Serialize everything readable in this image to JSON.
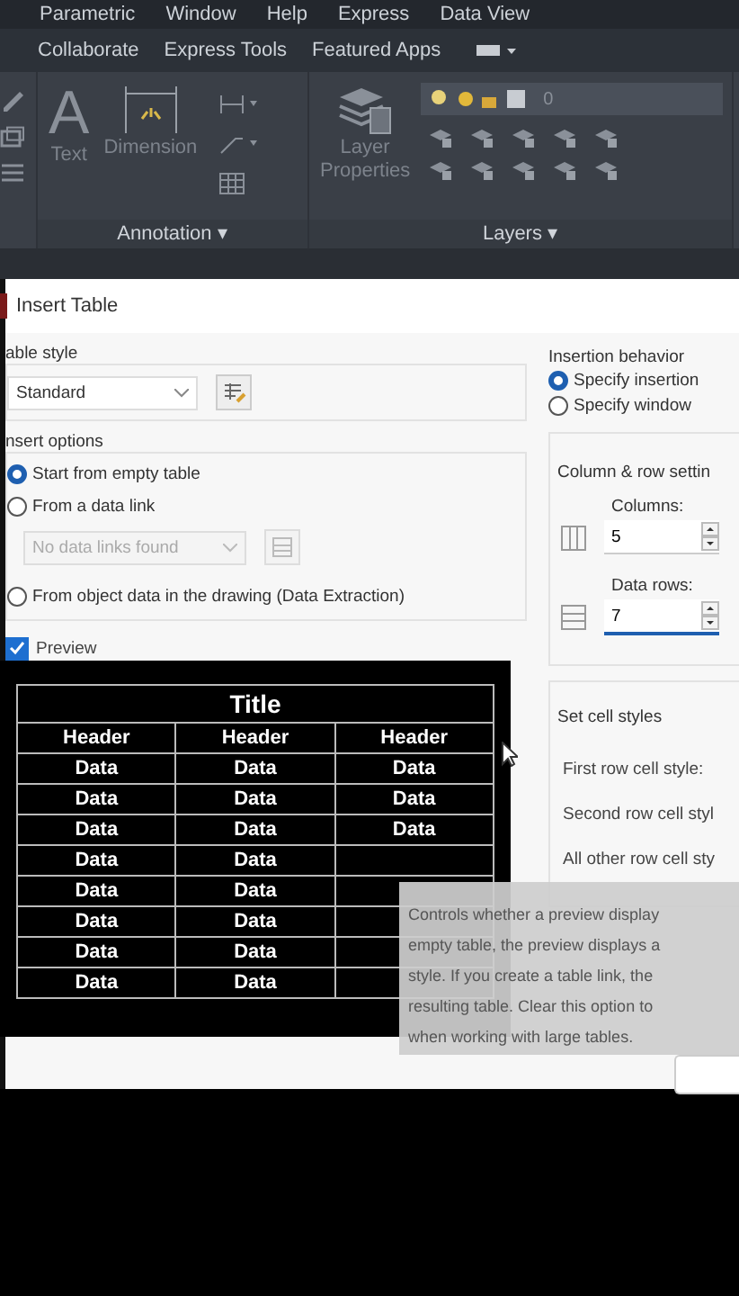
{
  "menu_bar": [
    "Parametric",
    "Window",
    "Help",
    "Express",
    "Data View"
  ],
  "ribbon_tabs": [
    "Collaborate",
    "Express Tools",
    "Featured Apps"
  ],
  "ribbon": {
    "annotation": {
      "text_tool": {
        "glyph": "A",
        "label": "Text"
      },
      "dimension_tool": {
        "label": "Dimension"
      },
      "panel_label": "Annotation",
      "caret": "▾"
    },
    "layers": {
      "tool_label_lines": [
        "Layer",
        "Properties"
      ],
      "current_layer": "0",
      "panel_label": "Layers",
      "caret": "▾"
    }
  },
  "dialog": {
    "title": "Insert Table",
    "table_style": {
      "label": "able style",
      "value": "Standard"
    },
    "insert_options": {
      "label": "nsert options",
      "options": [
        {
          "label": "Start from empty table",
          "selected": true
        },
        {
          "label": "From a data link",
          "selected": false
        },
        {
          "label": "From object data in the drawing (Data Extraction)",
          "selected": false
        }
      ],
      "data_link": {
        "placeholder": "No data links found",
        "disabled": true
      }
    },
    "preview": {
      "label": "Preview",
      "checked": true,
      "title": "Title",
      "headers": [
        "Header",
        "Header",
        "Header"
      ],
      "rows": [
        [
          "Data",
          "Data",
          "Data"
        ],
        [
          "Data",
          "Data",
          "Data"
        ],
        [
          "Data",
          "Data",
          "Data"
        ],
        [
          "Data",
          "Data"
        ],
        [
          "Data",
          "Data"
        ],
        [
          "Data",
          "Data"
        ],
        [
          "Data",
          "Data"
        ],
        [
          "Data",
          "Data"
        ]
      ]
    },
    "insertion_behavior": {
      "label": "Insertion behavior",
      "options": [
        {
          "label": "Specify insertion",
          "selected": true
        },
        {
          "label": "Specify window",
          "selected": false
        }
      ]
    },
    "column_row_settings": {
      "label": "Column & row settin",
      "columns": {
        "label": "Columns:",
        "value": "5"
      },
      "data_rows": {
        "label": "Data rows:",
        "value": "7"
      }
    },
    "cell_styles": {
      "label": "Set cell styles",
      "rows": [
        "First row cell style:",
        "Second row cell styl",
        "All other row cell sty"
      ]
    },
    "tooltip": {
      "lines": [
        "Controls whether a preview display",
        "empty table, the preview displays a",
        "style. If you create a table link, the",
        "resulting table. Clear this option to",
        "when working with large tables."
      ]
    }
  }
}
